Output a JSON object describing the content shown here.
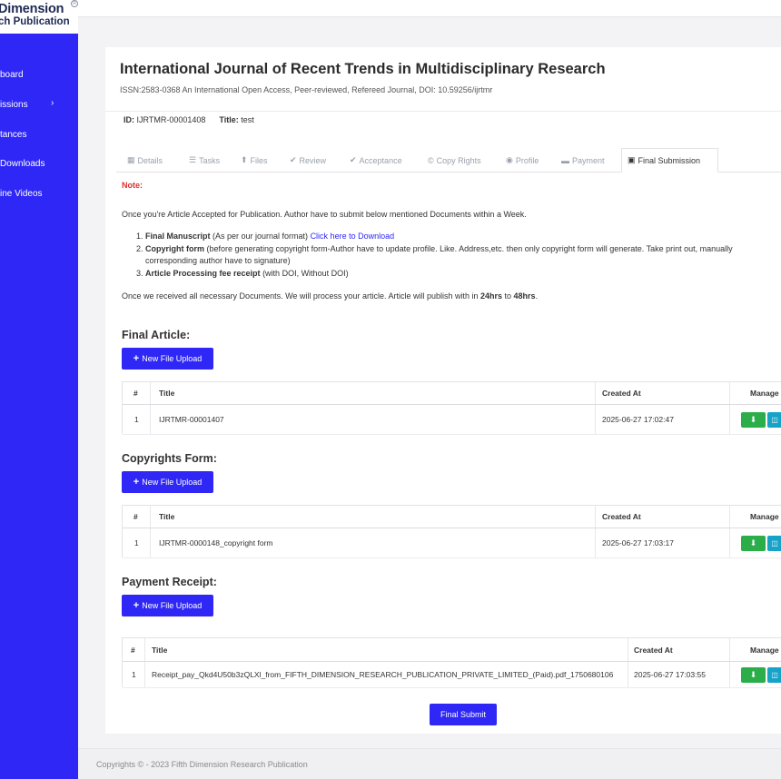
{
  "brand": {
    "line1": "Dimension",
    "line2": "ch Publication",
    "mark": "R"
  },
  "sidebar": {
    "items": [
      {
        "label": "board"
      },
      {
        "label": "issions",
        "chevron": "›"
      },
      {
        "label": "tances"
      },
      {
        "label": " Downloads"
      },
      {
        "label": "ine Videos"
      }
    ]
  },
  "journal": {
    "title": "International Journal of Recent Trends in Multidisciplinary Research",
    "issn": "ISSN:2583-0368 An International Open Access, Peer-reviewed, Refereed Journal, DOI: 10.59256/ijrtmr"
  },
  "article": {
    "id_label": "ID:",
    "id_value": "IJRTMR-00001408",
    "title_label": "Title:",
    "title_value": "test"
  },
  "tabs": [
    {
      "label": "Details",
      "icon": "▦"
    },
    {
      "label": "Tasks",
      "icon": "☰"
    },
    {
      "label": "Files",
      "icon": "⬆"
    },
    {
      "label": "Review",
      "icon": "✔"
    },
    {
      "label": "Acceptance",
      "icon": "✔"
    },
    {
      "label": "Copy Rights",
      "icon": "©"
    },
    {
      "label": "Profile",
      "icon": "◉"
    },
    {
      "label": "Payment",
      "icon": "▬"
    },
    {
      "label": "Final Submission",
      "icon": "▣"
    }
  ],
  "note": {
    "label": "Note:",
    "intro": "Once you're Article Accepted for Publication. Author have to submit below mentioned Documents within a Week.",
    "item1_bold": "Final Manuscript",
    "item1_text": " (As per our journal format) ",
    "item1_link": "Click here to Download",
    "item2_bold": "Copyright form",
    "item2_text": " (before generating copyright form-Author have to update profile. Like. Address,etc. then only copyright form will generate. Take print out, manually corresponding author have to signature)",
    "item3_bold": "Article Processing fee receipt",
    "item3_text": " (with DOI, Without DOI)",
    "outro_pre": "Once we received all necessary Documents. We will process your article. Article will publish with in ",
    "outro_b1": "24hrs",
    "outro_mid": " to ",
    "outro_b2": "48hrs",
    "outro_end": "."
  },
  "sections": {
    "final_article": {
      "heading": "Final Article:",
      "upload_label": "New File Upload",
      "columns": [
        "#",
        "Title",
        "Created At",
        "Manage"
      ],
      "rows": [
        {
          "num": "1",
          "title": "IJRTMR-00001407",
          "created": "2025-06-27 17:02:47"
        }
      ]
    },
    "copyrights": {
      "heading": "Copyrights Form:",
      "upload_label": "New File Upload",
      "columns": [
        "#",
        "Title",
        "Created At",
        "Manage"
      ],
      "rows": [
        {
          "num": "1",
          "title": "IJRTMR-0000148_copyright form",
          "created": "2025-06-27 17:03:17"
        }
      ]
    },
    "payment": {
      "heading": "Payment Receipt:",
      "upload_label": "New File Upload",
      "columns": [
        "#",
        "Title",
        "Created At",
        "Manage"
      ],
      "rows": [
        {
          "num": "1",
          "title": "Receipt_pay_Qkd4U50b3zQLXl_from_FIFTH_DIMENSION_RESEARCH_PUBLICATION_PRIVATE_LIMITED_(Paid).pdf_1750680106",
          "created": "2025-06-27 17:03:55"
        }
      ]
    }
  },
  "final_submit_label": "Final Submit",
  "footer": {
    "text": "Copyrights © - 2023 Fifth Dimension Research Publication"
  },
  "colors": {
    "primary": "#2e27f5",
    "success": "#2bae4a",
    "info": "#17a2c8",
    "danger": "#e03131"
  }
}
